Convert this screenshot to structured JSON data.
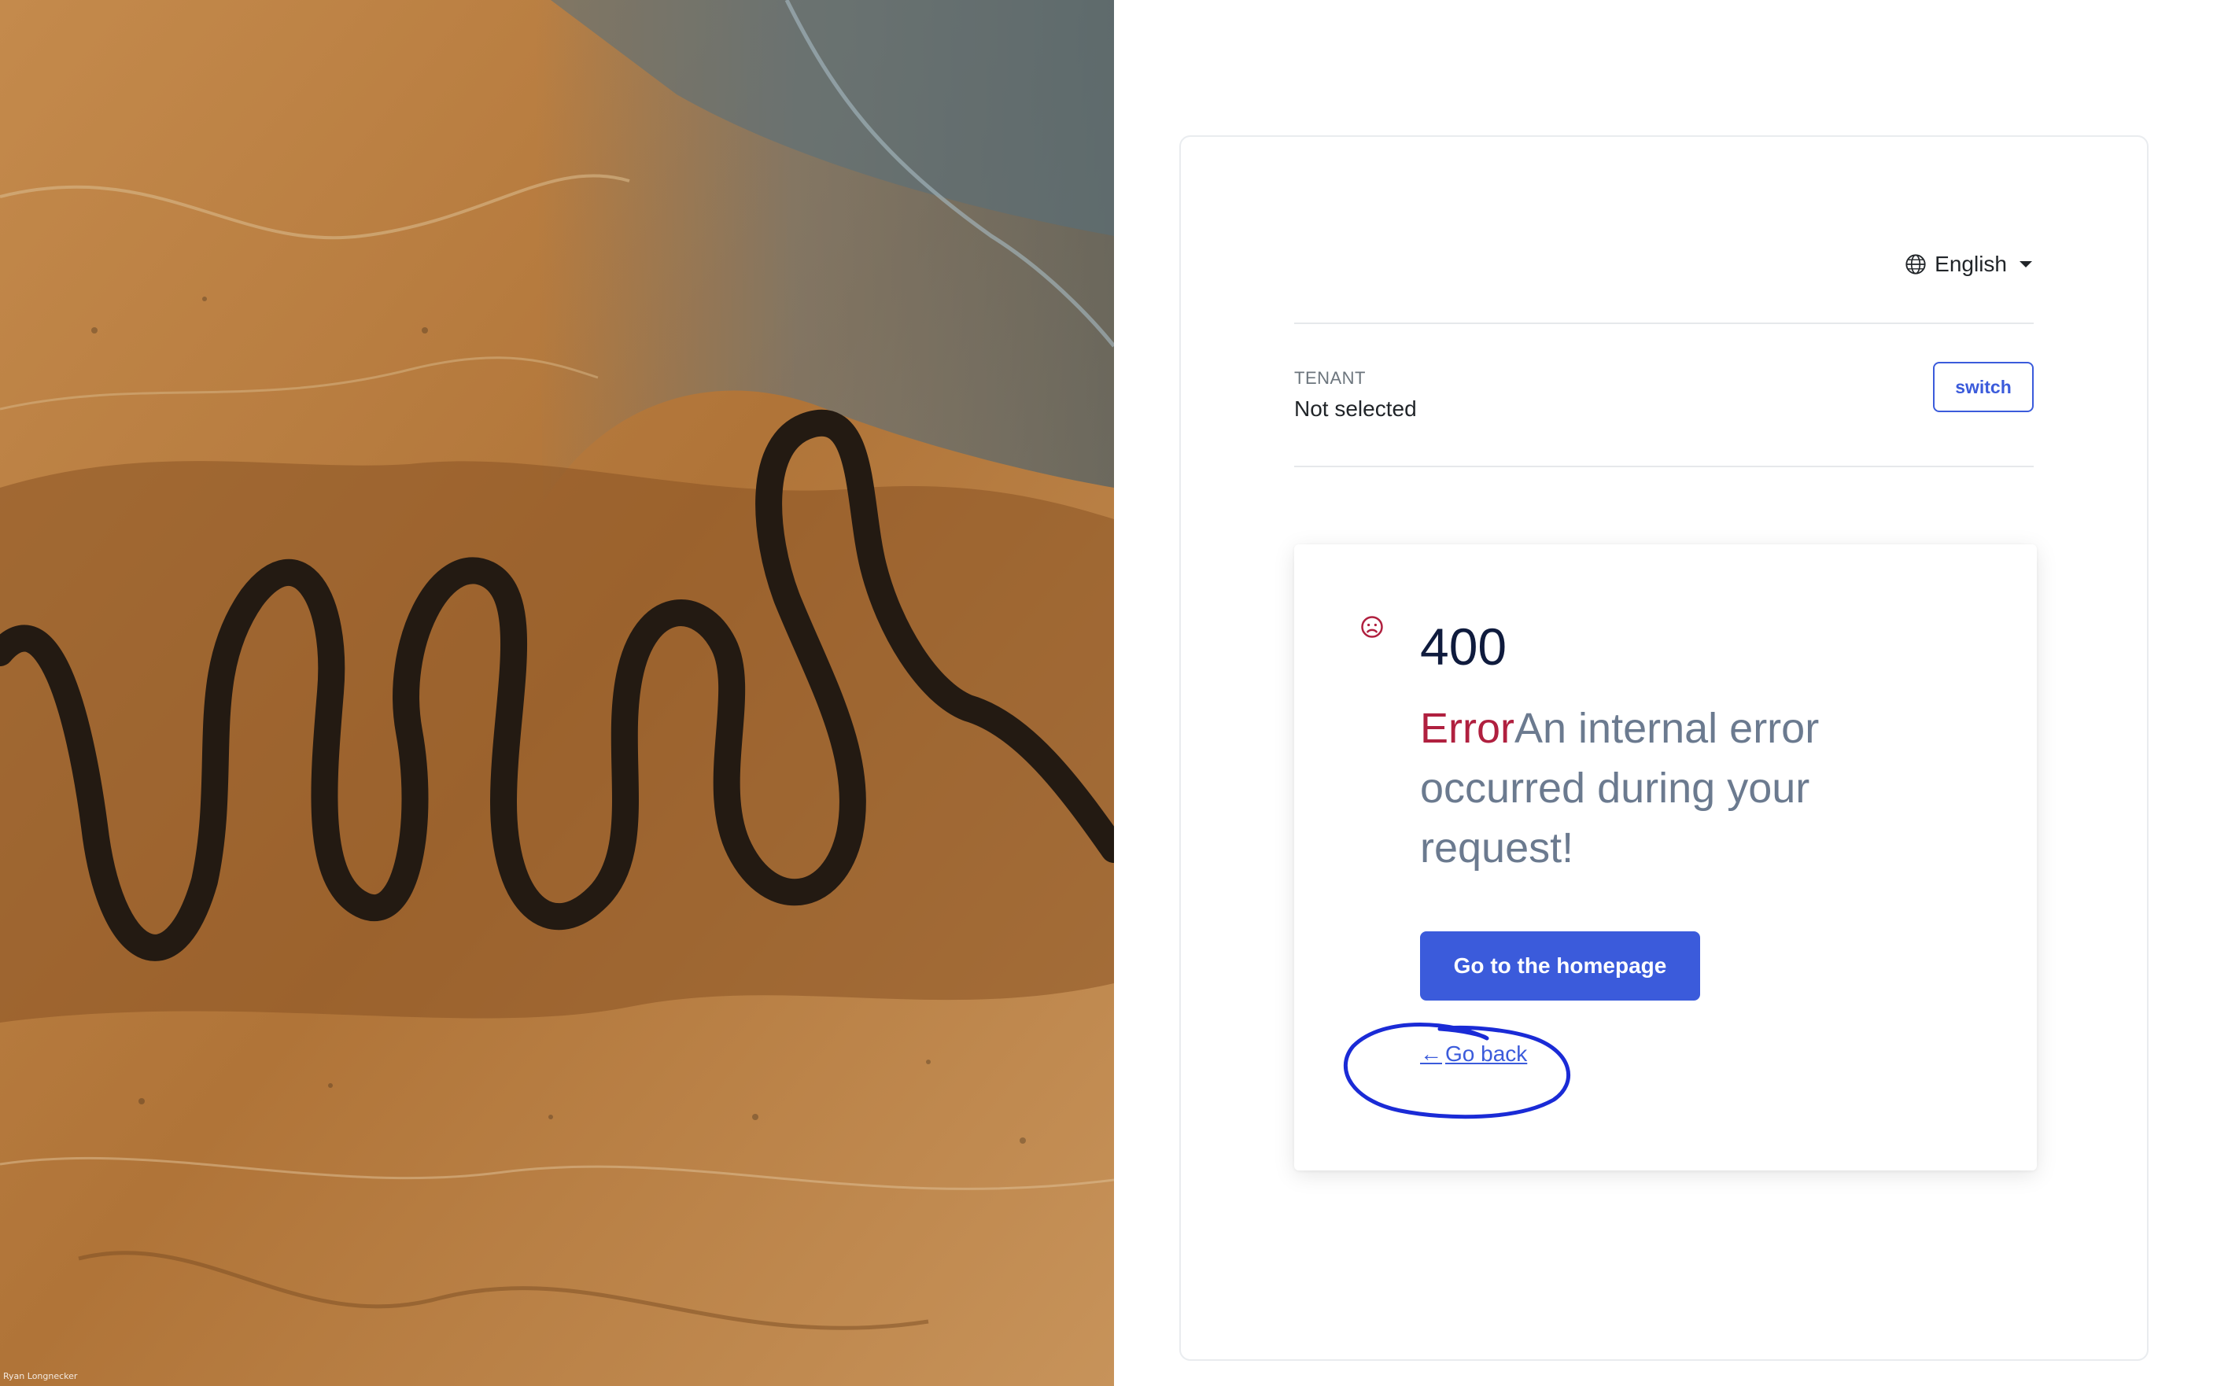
{
  "hero": {
    "photo_credit": "Ryan Longnecker"
  },
  "language": {
    "selected": "English",
    "icon": "globe-icon"
  },
  "tenant": {
    "label": "TENANT",
    "value": "Not selected",
    "switch_label": "switch"
  },
  "error": {
    "code": "400",
    "icon": "sad-face-icon",
    "title_word": "Error",
    "message": "An internal error occurred during your request!",
    "home_button": "Go to the homepage",
    "back_arrow": "←",
    "back_link": "Go back"
  },
  "colors": {
    "primary": "#3b5bdb",
    "error": "#b0203f",
    "heading": "#0f1b3d",
    "muted": "#6b7a8f",
    "annotation": "#1a2bd6"
  }
}
